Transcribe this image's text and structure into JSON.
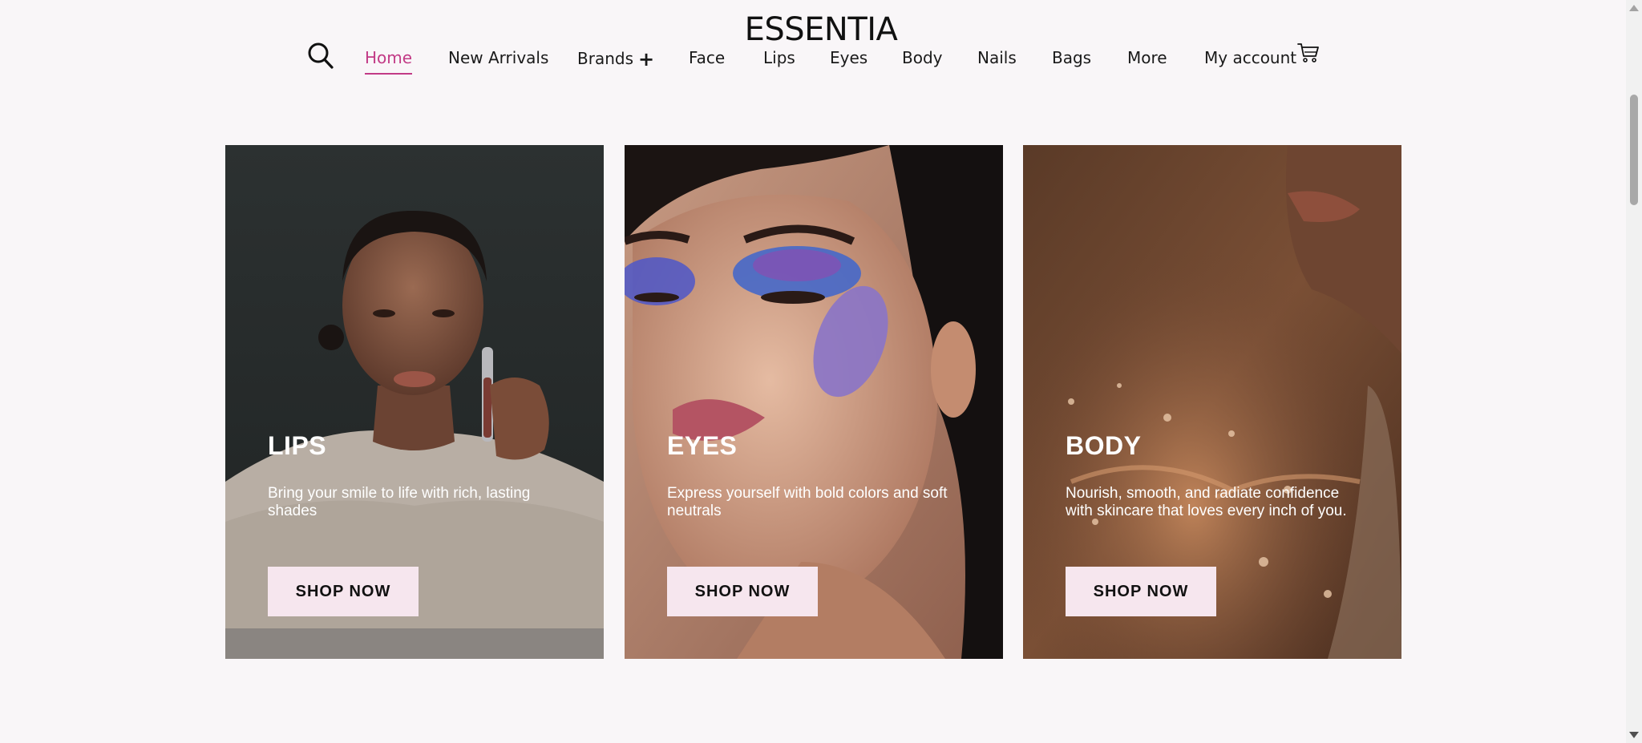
{
  "header": {
    "logo": "ESSENTIA"
  },
  "nav": {
    "items": [
      "Home",
      "New Arrivals",
      "Brands",
      "Face",
      "Lips",
      "Eyes",
      "Body",
      "Nails",
      "Bags",
      "More",
      "My account"
    ],
    "active": "Home",
    "search_icon": "search-icon",
    "cart_icon": "cart-icon",
    "brands_expand_icon": "plus-icon"
  },
  "cards": [
    {
      "title": "LIPS",
      "description": "Bring your smile to life with rich, lasting shades",
      "button": "SHOP NOW"
    },
    {
      "title": "EYES",
      "description": "Express yourself with bold colors and soft neutrals",
      "button": "SHOP NOW"
    },
    {
      "title": "BODY",
      "description": "Nourish, smooth, and radiate confidence with skincare that loves every inch of you.",
      "button": "SHOP NOW"
    }
  ],
  "colors": {
    "accent": "#c23a86",
    "background": "#f9f6f8",
    "button_bg": "#f6e6ee"
  }
}
